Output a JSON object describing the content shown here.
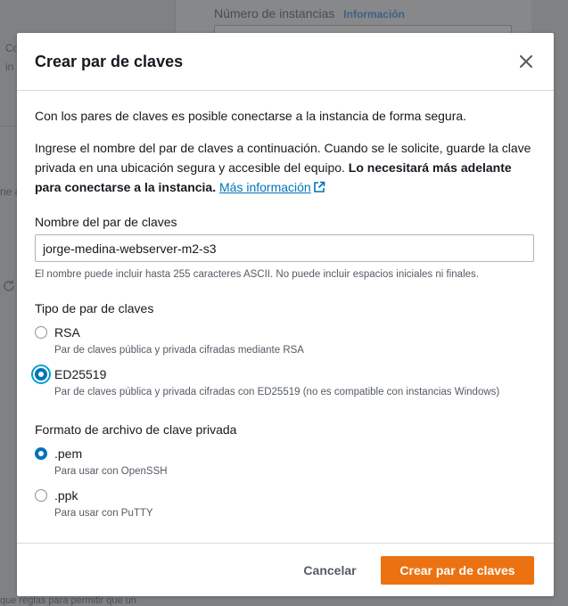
{
  "background": {
    "field_label": "Número de instancias",
    "field_info": "Información",
    "side_text_1": "Co",
    "side_text_2": "in",
    "side_text_3": "ne a",
    "bottom_text": "que reglas para permitir que un"
  },
  "modal": {
    "title": "Crear par de claves",
    "intro": "Con los pares de claves es posible conectarse a la instancia de forma segura.",
    "instruction": "Ingrese el nombre del par de claves a continuación. Cuando se le solicite, guarde la clave privada en una ubicación segura y accesible del equipo. ",
    "instruction_bold": "Lo necesitará más adelante para conectarse a la instancia.",
    "more_info_link": "Más información",
    "name_field": {
      "label": "Nombre del par de claves",
      "value": "jorge-medina-webserver-m2-s3",
      "constraint": "El nombre puede incluir hasta 255 caracteres ASCII. No puede incluir espacios iniciales ni finales."
    },
    "key_type": {
      "label": "Tipo de par de claves",
      "options": [
        {
          "title": "RSA",
          "desc": "Par de claves pública y privada cifradas mediante RSA",
          "checked": false
        },
        {
          "title": "ED25519",
          "desc": "Par de claves pública y privada cifradas con ED25519 (no es compatible con instancias Windows)",
          "checked": true
        }
      ]
    },
    "file_format": {
      "label": "Formato de archivo de clave privada",
      "options": [
        {
          "title": ".pem",
          "desc": "Para usar con OpenSSH",
          "checked": true
        },
        {
          "title": ".ppk",
          "desc": "Para usar con PuTTY",
          "checked": false
        }
      ]
    },
    "cancel_label": "Cancelar",
    "submit_label": "Crear par de claves"
  },
  "colors": {
    "accent": "#0073bb",
    "primary_button": "#ec7211"
  }
}
